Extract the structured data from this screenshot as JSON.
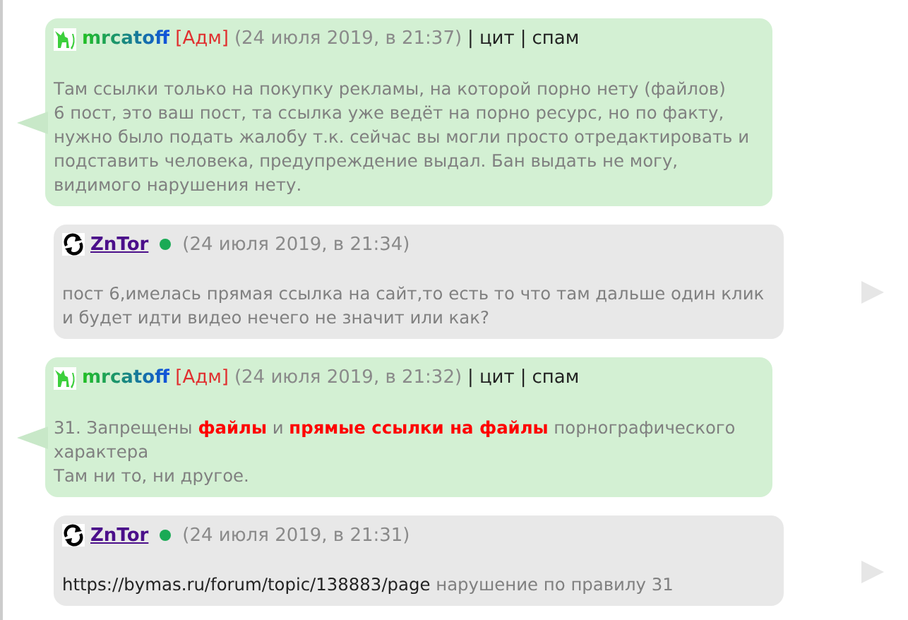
{
  "messages": [
    {
      "kind": "admin",
      "author": "mrcatoff",
      "role": "[Адм]",
      "time": "(24 июля 2019, в 21:37)",
      "actions": [
        {
          "separator": "|",
          "label": "цит"
        },
        {
          "separator": "|",
          "label": "спам"
        }
      ],
      "parts": [
        {
          "kind": "text",
          "text": "Там ссылки только на покупку рекламы, на которой порно нету (файлов)\n6 пост, это ваш пост, та ссылка уже ведёт на порно ресурс, но по факту, нужно было подать жалобу т.к. сейчас вы могли просто отредактировать и подставить человека, предупреждение выдал. Бан выдать не могу, видимого нарушения нету."
        }
      ]
    },
    {
      "kind": "user",
      "author": "ZnTor",
      "online": true,
      "time": "(24 июля 2019, в 21:34)",
      "parts": [
        {
          "kind": "text",
          "text": "пост 6,имелась прямая ссылка на сайт,то есть то что там дальше один клик и будет идти видео нечего не значит или как?"
        }
      ]
    },
    {
      "kind": "admin",
      "author": "mrcatoff",
      "role": "[Адм]",
      "time": "(24 июля 2019, в 21:32)",
      "actions": [
        {
          "separator": "|",
          "label": "цит"
        },
        {
          "separator": "|",
          "label": "спам"
        }
      ],
      "parts": [
        {
          "kind": "text",
          "text": "31. Запрещены **файлы** и **прямые ссылки на файлы** порнографического характера\nТам ни то, ни другое."
        }
      ]
    },
    {
      "kind": "user",
      "author": "ZnTor",
      "online": true,
      "time": "(24 июля 2019, в 21:31)",
      "parts": [
        {
          "kind": "link",
          "text": "https://bymas.ru/forum/topic/138883/page"
        },
        {
          "kind": "text",
          "text": " нарушение по правилу 31"
        }
      ]
    }
  ]
}
